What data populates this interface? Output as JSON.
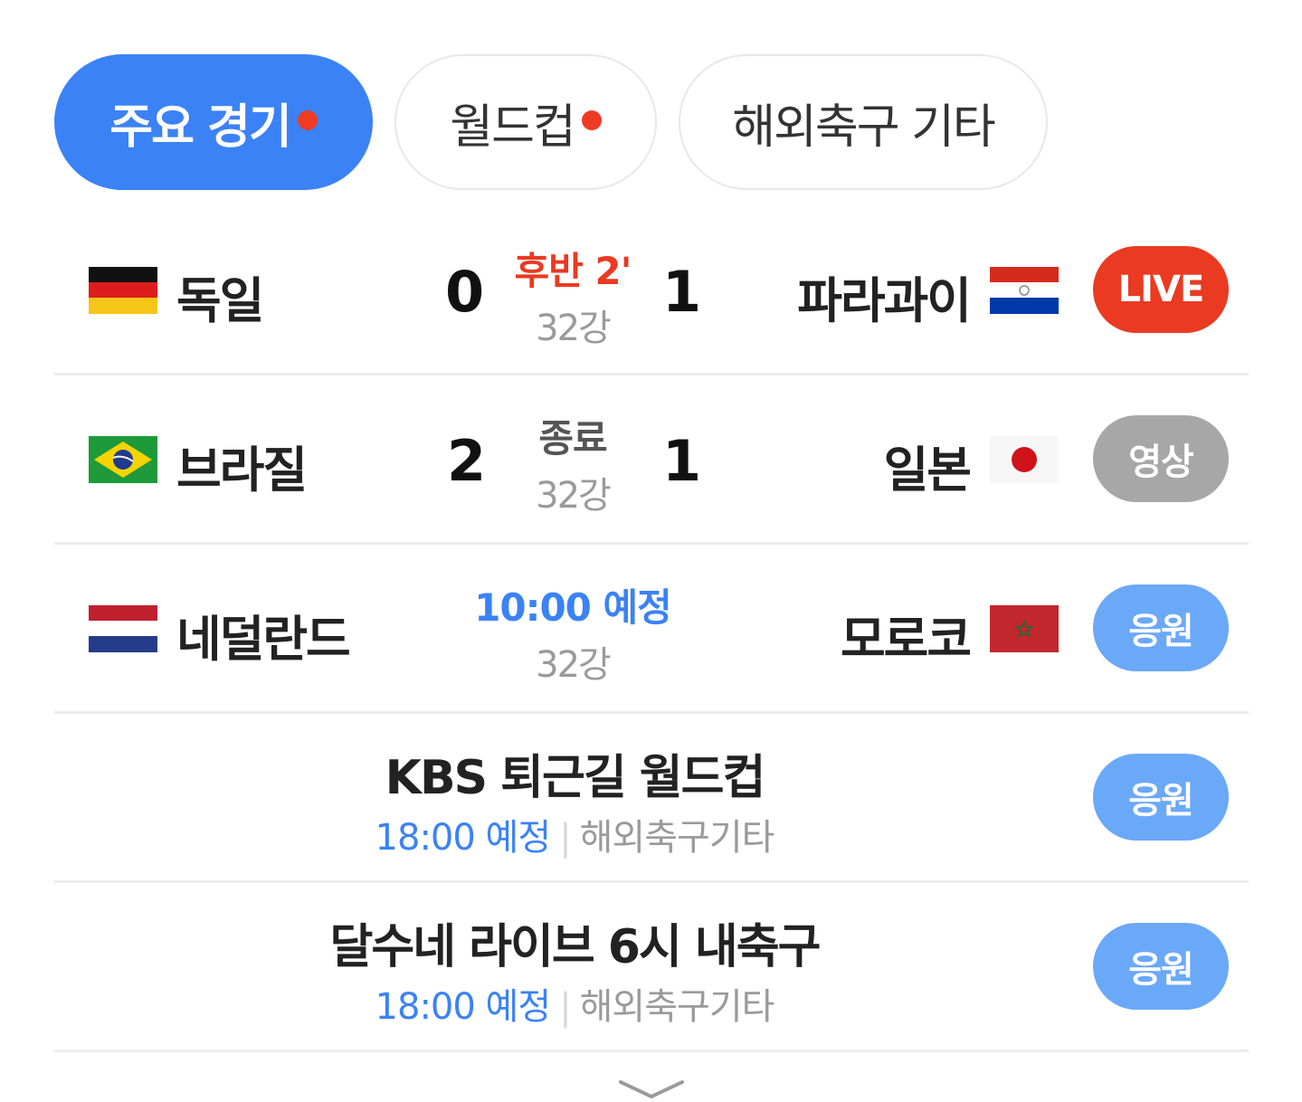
{
  "tabs": [
    {
      "label": "주요 경기",
      "active": true,
      "has_dot": true
    },
    {
      "label": "월드컵",
      "active": false,
      "has_dot": true
    },
    {
      "label": "해외축구 기타",
      "active": false,
      "has_dot": false
    }
  ],
  "matches": [
    {
      "home": {
        "name": "독일",
        "flag": "germany-flag"
      },
      "away": {
        "name": "파라과이",
        "flag": "paraguay-flag"
      },
      "home_score": "0",
      "away_score": "1",
      "status": "후반 2'",
      "status_color": "#ea3a22",
      "round": "32강",
      "button": {
        "label": "LIVE",
        "color": "#ea3a22"
      }
    },
    {
      "home": {
        "name": "브라질",
        "flag": "brazil-flag"
      },
      "away": {
        "name": "일본",
        "flag": "japan-flag"
      },
      "home_score": "2",
      "away_score": "1",
      "status": "종료",
      "status_color": "#555555",
      "round": "32강",
      "button": {
        "label": "영상",
        "color": "#a7a7a7"
      }
    },
    {
      "home": {
        "name": "네덜란드",
        "flag": "netherlands-flag"
      },
      "away": {
        "name": "모로코",
        "flag": "morocco-flag"
      },
      "status": "10:00 예정",
      "status_color": "#3b82f6",
      "round": "32강",
      "button": {
        "label": "응원",
        "color": "#6aa8f8"
      }
    }
  ],
  "events": [
    {
      "title": "KBS 퇴근길 월드컵",
      "time": "18:00 예정",
      "separator": "|",
      "category": "해외축구기타",
      "button": {
        "label": "응원"
      }
    },
    {
      "title": "달수네 라이브 6시 내축구",
      "time": "18:00 예정",
      "separator": "|",
      "category": "해외축구기타",
      "button": {
        "label": "응원"
      }
    }
  ],
  "more_icon": "chevron-down-icon"
}
